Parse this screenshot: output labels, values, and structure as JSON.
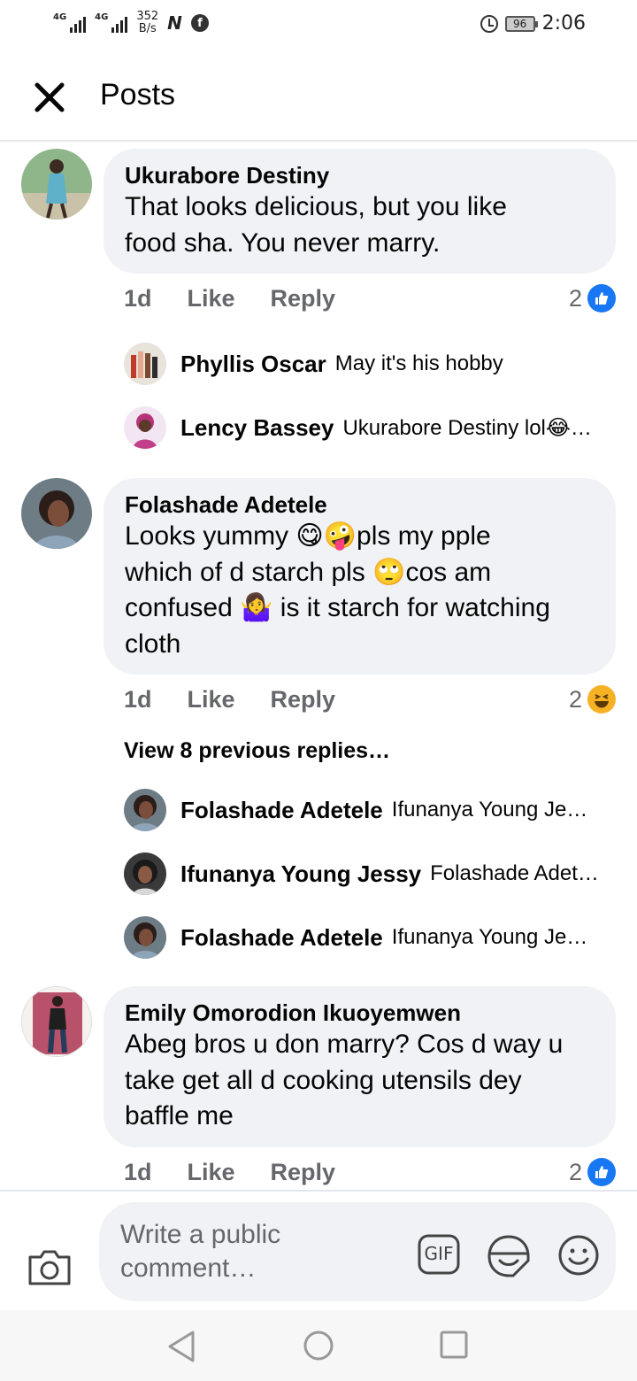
{
  "status": {
    "net1": "4G",
    "net2": "4G",
    "speed_value": "352",
    "speed_unit": "B/s",
    "battery": "96",
    "time": "2:06"
  },
  "header": {
    "title": "Posts"
  },
  "comments": [
    {
      "author": "Ukurabore Destiny",
      "lines": [
        "That looks delicious, but you like",
        "food sha.  You never marry."
      ],
      "time": "1d",
      "like": "Like",
      "reply": "Reply",
      "reaction_count": "2",
      "reaction": "like-icon",
      "replies": [
        {
          "name": "Phyllis Oscar",
          "text": "May it's his hobby"
        },
        {
          "name": "Lency Bassey",
          "text": "Ukurabore Destiny lol😂…"
        }
      ]
    },
    {
      "author": "Folashade Adetele",
      "lines": [
        "Looks yummy 😋🤪pls my pple",
        "which of d starch pls 🙄cos am",
        "confused 🤷‍♀️ is it starch for watching",
        "cloth"
      ],
      "time": "1d",
      "like": "Like",
      "reply": "Reply",
      "reaction_count": "2",
      "reaction": "haha-icon",
      "view_previous": "View 8 previous replies…",
      "replies": [
        {
          "name": "Folashade Adetele",
          "text": "Ifunanya Young Je…"
        },
        {
          "name": "Ifunanya Young Jessy",
          "text": "Folashade Adet…"
        },
        {
          "name": "Folashade Adetele",
          "text": "Ifunanya Young Je…"
        }
      ]
    },
    {
      "author": "Emily Omorodion Ikuoyemwen",
      "lines": [
        "Abeg bros u don marry? Cos d way u",
        "take get all d cooking utensils dey",
        "baffle me"
      ],
      "time": "1d",
      "like": "Like",
      "reply": "Reply",
      "reaction_count": "2",
      "reaction": "like-icon"
    }
  ],
  "composer": {
    "placeholder_line1": "Write a public",
    "placeholder_line2": "comment…",
    "gif_label": "GIF"
  },
  "colors": {
    "accent": "#1877f2",
    "bubble": "#f0f2f5",
    "meta": "#65676b",
    "haha": "#f7b125"
  }
}
